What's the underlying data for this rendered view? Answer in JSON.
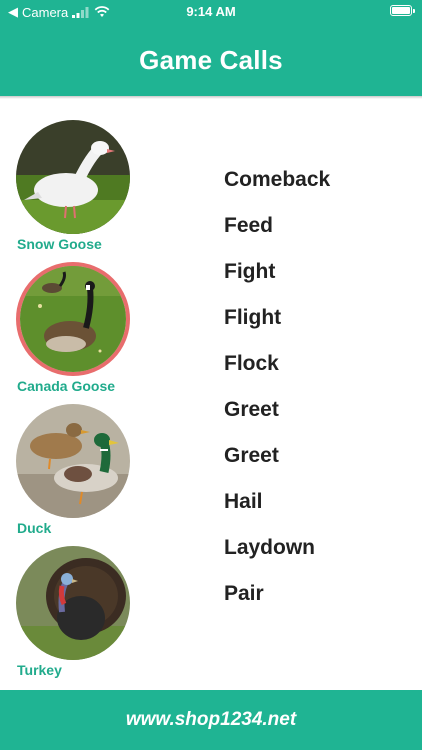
{
  "status_bar": {
    "back_label": "Camera",
    "time": "9:14 AM"
  },
  "nav": {
    "title": "Game Calls"
  },
  "birds": [
    {
      "name": "Snow Goose",
      "selected": false
    },
    {
      "name": "Canada Goose",
      "selected": true
    },
    {
      "name": "Duck",
      "selected": false
    },
    {
      "name": "Turkey",
      "selected": false
    }
  ],
  "calls": [
    "Comeback",
    "Feed",
    "Fight",
    "Flight",
    "Flock",
    "Greet",
    "Greet",
    "Hail",
    "Laydown",
    "Pair"
  ],
  "footer": {
    "url": "www.shop1234.net"
  },
  "colors": {
    "accent": "#1fb493",
    "label": "#21ab8c",
    "selected_ring": "#e86d6d"
  }
}
